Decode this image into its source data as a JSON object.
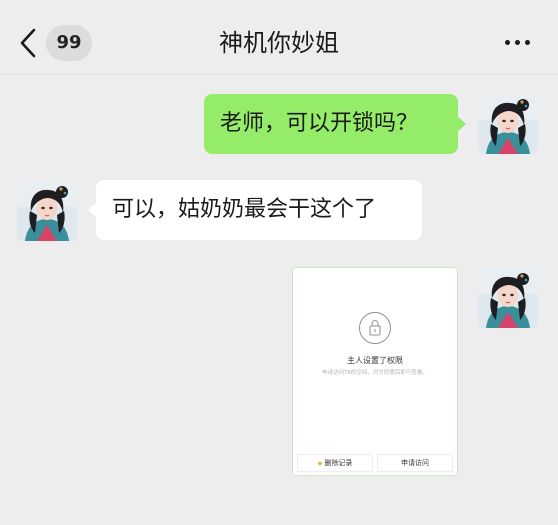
{
  "header": {
    "back_count": "99",
    "title": "神机你妙姐"
  },
  "messages": [
    {
      "sender": "me",
      "text": "老师，可以开锁吗？"
    },
    {
      "sender": "other",
      "text": "可以，姑奶奶最会干这个了"
    }
  ],
  "image_message": {
    "title": "主人设置了权限",
    "subtitle": "申请访问TA的空间，对方同意后即可查看。",
    "delete_label": "删除记录",
    "request_label": "申请访问"
  },
  "colors": {
    "bubble_me": "#95ec69",
    "bubble_other": "#ffffff",
    "background": "#ededed"
  },
  "icons": {
    "back": "chevron-left-icon",
    "more": "more-dots-icon",
    "lock": "lock-icon",
    "delete_record": "delete-record-icon"
  }
}
